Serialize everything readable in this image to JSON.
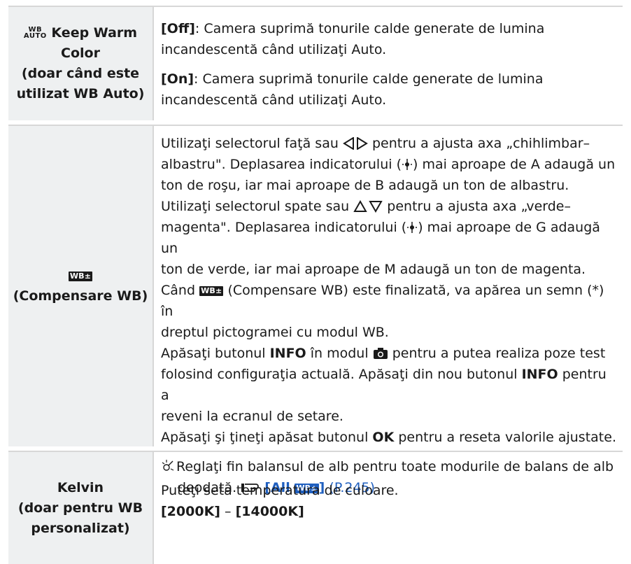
{
  "rows": [
    {
      "left": {
        "icon_top": "WB",
        "icon_bottom": "AUTO",
        "title": "Keep Warm",
        "title2": "Color",
        "sub1": "(doar când este",
        "sub2": "utilizat WB Auto)"
      },
      "right": {
        "p1_key": "[Off]",
        "p1_text": ": Camera suprimă tonurile calde generate de lumina",
        "p1_text2": "incandescentă când utilizaţi Auto.",
        "p2_key": "[On]",
        "p2_text": ": Camera suprimă tonurile calde generate de lumina",
        "p2_text2": "incandescentă când utilizaţi Auto."
      }
    },
    {
      "left": {
        "icon_label": "WB±",
        "title": "(Compensare WB)"
      },
      "right": {
        "l1a": "Utilizaţi selectorul faţă sau ",
        "l1b": " pentru a ajusta axa „chihlimbar–",
        "l2": "albastru\". Deplasarea indicatorului (",
        "l2b": ") mai aproape de A adaugă un",
        "l3": "ton de roşu, iar mai aproape de B adaugă un ton de albastru.",
        "l4a": "Utilizaţi selectorul spate sau ",
        "l4b": " pentru a ajusta axa „verde–",
        "l5": "magenta\". Deplasarea indicatorului (",
        "l5b": ") mai aproape de G adaugă un",
        "l6": "ton de verde, iar mai aproape de M adaugă un ton de magenta.",
        "l7a": "Când ",
        "l7b": " (Compensare WB) este finalizată, va apărea un semn (*) în",
        "l8": "dreptul pictogramei cu modul WB.",
        "l9a": "Apăsaţi butonul ",
        "info": "INFO",
        "l9b": " în modul ",
        "l9c": " pentru a putea realiza poze test",
        "l10a": "folosind configuraţia actuală. Apăsaţi din nou butonul ",
        "l10b": " pentru a",
        "l11": "reveni la ecranul de setare.",
        "l12a": "Apăsaţi şi ţineţi apăsat butonul ",
        "ok": "OK",
        "l12b": " pentru a reseta valorile ajustate.",
        "tip1": "Reglaţi fin balansul de alb pentru toate modurile de balans de alb",
        "tip2": "deodată. ",
        "ref_key": "[All ",
        "ref_key_end": "]",
        "ref_page": "(P.245)"
      }
    },
    {
      "left": {
        "title": "Kelvin",
        "sub1": "(doar pentru WB",
        "sub2": "personalizat)"
      },
      "right": {
        "text": "Puteţi seta temperatura de culoare.",
        "min": "[2000K]",
        "dash": " – ",
        "max": "[14000K]"
      }
    }
  ]
}
